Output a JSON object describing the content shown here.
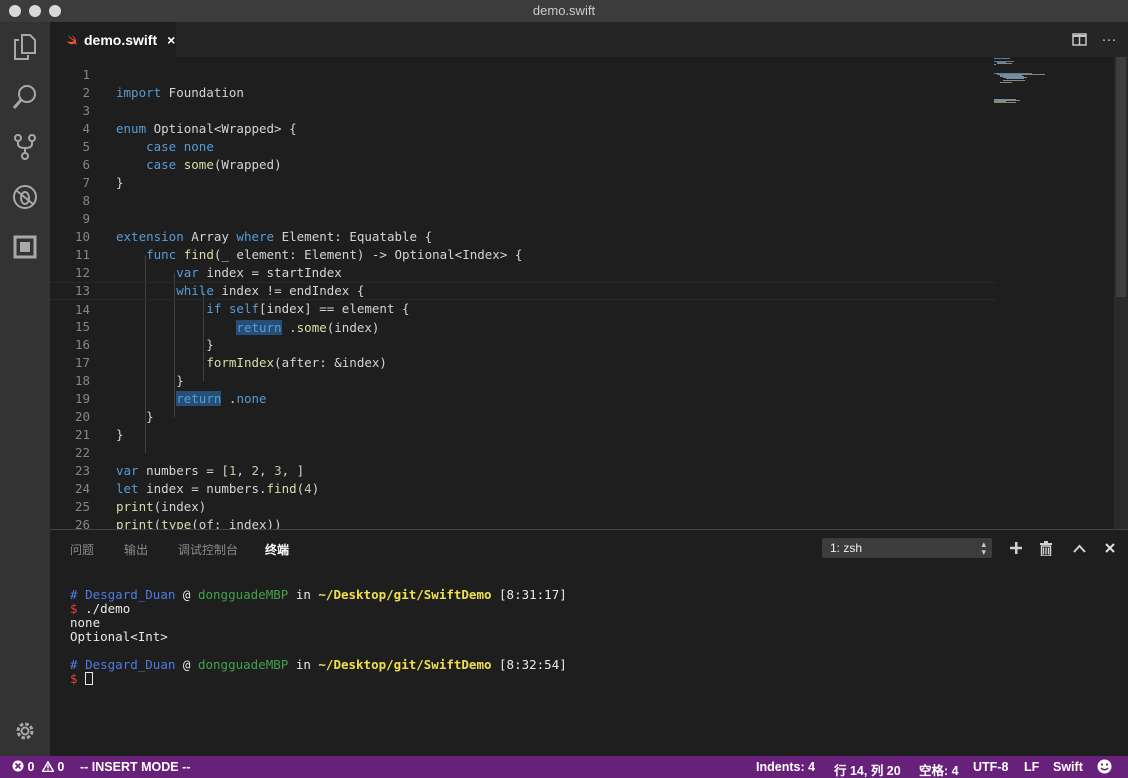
{
  "window": {
    "title": "demo.swift"
  },
  "tab": {
    "filename": "demo.swift",
    "close": "×"
  },
  "editor": {
    "lines": [
      {
        "n": "1",
        "code": "import Foundation"
      },
      {
        "n": "2",
        "code": ""
      },
      {
        "n": "3",
        "code": "enum Optional<Wrapped> {"
      },
      {
        "n": "4",
        "code": "    case none"
      },
      {
        "n": "5",
        "code": "    case some(Wrapped)"
      },
      {
        "n": "6",
        "code": "}"
      },
      {
        "n": "7",
        "code": ""
      },
      {
        "n": "8",
        "code": ""
      },
      {
        "n": "9",
        "code": "extension Array where Element: Equatable {"
      },
      {
        "n": "10",
        "code": "    func find(_ element: Element) -> Optional<Index> {"
      },
      {
        "n": "11",
        "code": "        var index = startIndex"
      },
      {
        "n": "12",
        "code": "        while index != endIndex {"
      },
      {
        "n": "13",
        "code": "            if self[index] == element {"
      },
      {
        "n": "14",
        "code": "                return .some(index)"
      },
      {
        "n": "15",
        "code": "            }"
      },
      {
        "n": "16",
        "code": "            formIndex(after: &index)"
      },
      {
        "n": "17",
        "code": "        }"
      },
      {
        "n": "18",
        "code": "        return .none"
      },
      {
        "n": "19",
        "code": "    }"
      },
      {
        "n": "20",
        "code": "}"
      },
      {
        "n": "21",
        "code": ""
      },
      {
        "n": "22",
        "code": "var numbers = [1, 2, 3, ]"
      },
      {
        "n": "23",
        "code": "let index = numbers.find(4)"
      },
      {
        "n": "24",
        "code": "print(index)"
      },
      {
        "n": "25",
        "code": "print(type(of: index))"
      },
      {
        "n": "26",
        "code": ""
      }
    ]
  },
  "panel": {
    "tabs": [
      "问题",
      "输出",
      "调试控制台",
      "终端"
    ],
    "active_tab": "终端",
    "terminal_select": "1: zsh",
    "terminal": {
      "prompt1": {
        "hash": "#",
        "user": "Desgard_Duan",
        "at": "@",
        "host": "dongguadeMBP",
        "in": "in",
        "path": "~/Desktop/git/SwiftDemo",
        "time": "[8:31:17]"
      },
      "cmd1": "./demo",
      "output": [
        "none",
        "Optional<Int>"
      ],
      "prompt2": {
        "hash": "#",
        "user": "Desgard_Duan",
        "at": "@",
        "host": "dongguadeMBP",
        "in": "in",
        "path": "~/Desktop/git/SwiftDemo",
        "time": "[8:32:54]"
      },
      "dollar": "$"
    }
  },
  "statusbar": {
    "errors": "0",
    "warnings": "0",
    "mode": "-- INSERT MODE --",
    "indents": "Indents: 4",
    "position": "行 14, 列 20",
    "spaces": "空格: 4",
    "encoding": "UTF-8",
    "eol": "LF",
    "language": "Swift"
  },
  "colors": {
    "statusbar": "#68217a",
    "activitybar": "#333333",
    "editor_bg": "#1e1e1e",
    "keyword": "#569cd6",
    "function": "#dcdcaa",
    "number": "#b5cea8"
  }
}
